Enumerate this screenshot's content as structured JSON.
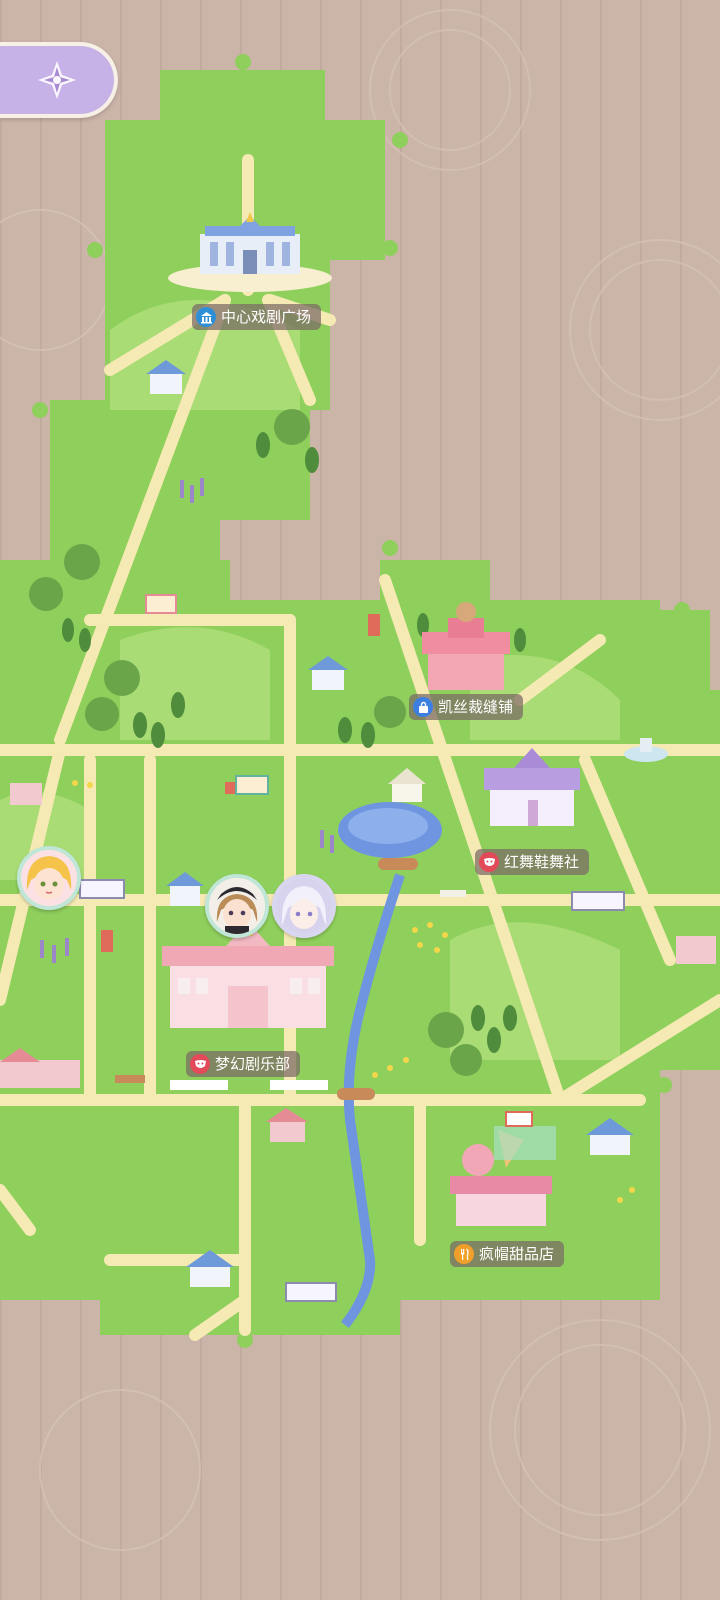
{
  "map": {
    "locations": [
      {
        "label": "中心戏剧广场",
        "icon": "theater-icon",
        "color": "#2f8fd6"
      },
      {
        "label": "凯丝裁缝铺",
        "icon": "shopping-bag-icon",
        "color": "#3d7fe0"
      },
      {
        "label": "红舞鞋舞社",
        "icon": "mask-icon",
        "color": "#e24a5a"
      },
      {
        "label": "梦幻剧乐部",
        "icon": "mask-icon",
        "color": "#e24a5a"
      },
      {
        "label": "疯帽甜品店",
        "icon": "fork-icon",
        "color": "#f0a02a"
      }
    ],
    "avatars": [
      {
        "name": "blonde-girl-avatar"
      },
      {
        "name": "brown-hair-avatar"
      },
      {
        "name": "silver-hair-avatar"
      }
    ]
  },
  "colors": {
    "background": "#c9b2a6",
    "grass": "#8fcf5c",
    "grass_light": "#a9dc74",
    "road": "#f6eab4",
    "river": "#6f95e0",
    "back_button": "#c7b2e8"
  },
  "nav": {
    "back_icon": "compass-star-icon"
  }
}
